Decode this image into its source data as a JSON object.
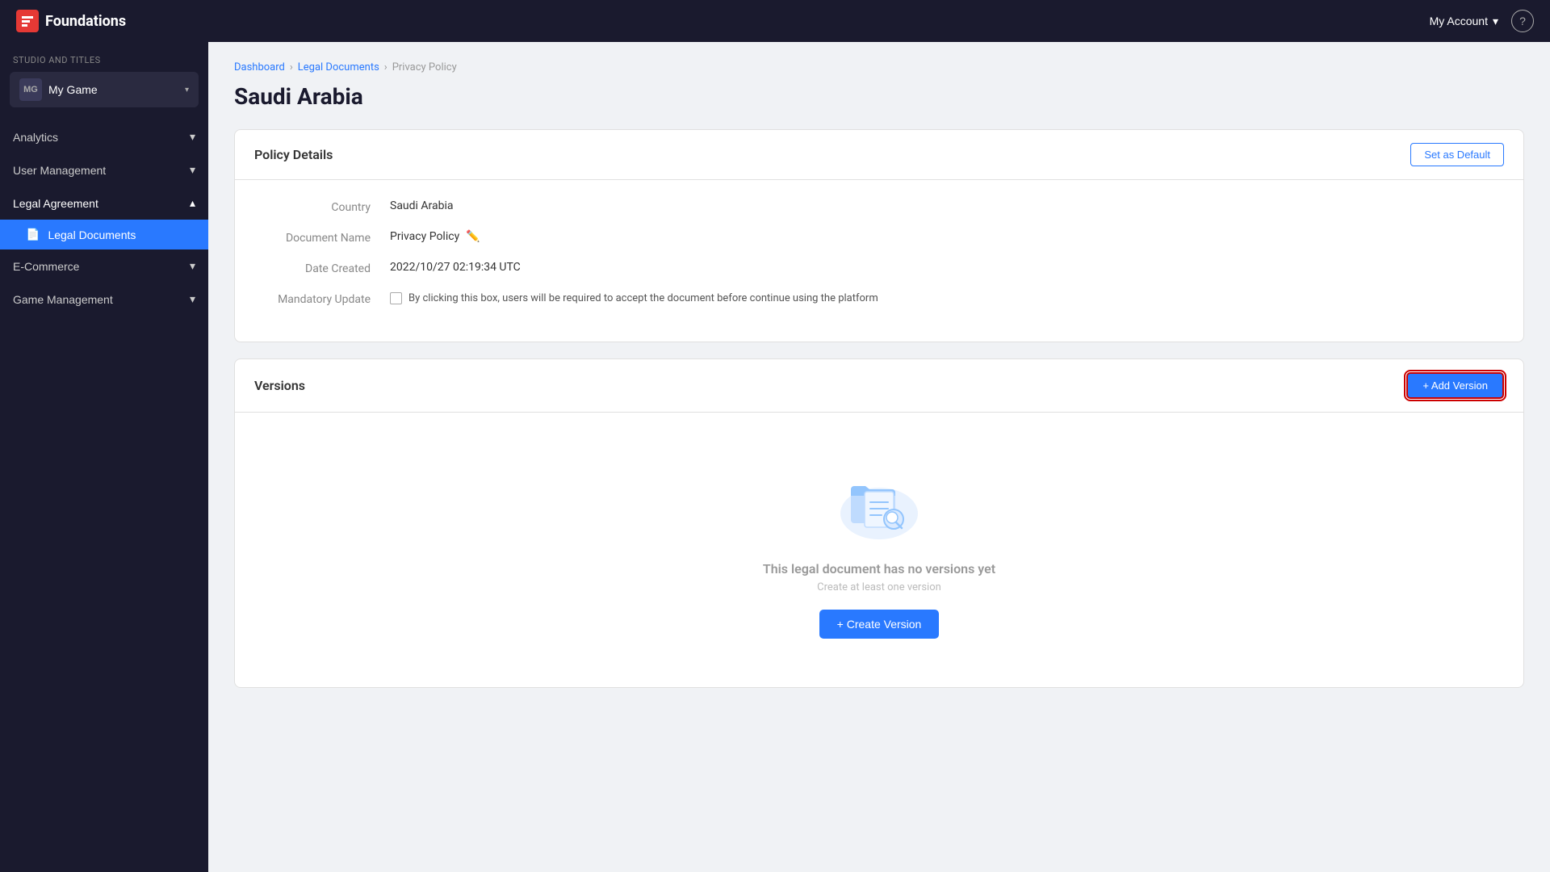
{
  "topnav": {
    "brand_label": "Foundations",
    "my_account_label": "My Account",
    "help_label": "?"
  },
  "sidebar": {
    "studio_label": "STUDIO AND TITLES",
    "studio_avatar": "MG",
    "studio_name": "My Game",
    "nav_items": [
      {
        "id": "analytics",
        "label": "Analytics",
        "has_children": true,
        "expanded": false
      },
      {
        "id": "user-management",
        "label": "User Management",
        "has_children": true,
        "expanded": false
      },
      {
        "id": "legal-agreement",
        "label": "Legal Agreement",
        "has_children": true,
        "expanded": true
      },
      {
        "id": "legal-documents",
        "label": "Legal Documents",
        "active": true,
        "sub": true
      },
      {
        "id": "e-commerce",
        "label": "E-Commerce",
        "has_children": true,
        "expanded": false
      },
      {
        "id": "game-management",
        "label": "Game Management",
        "has_children": true,
        "expanded": false
      }
    ]
  },
  "breadcrumb": {
    "items": [
      "Dashboard",
      "Legal Documents",
      "Privacy Policy"
    ]
  },
  "page": {
    "title": "Saudi Arabia"
  },
  "policy_details": {
    "card_title": "Policy Details",
    "set_default_label": "Set as Default",
    "country_label": "Country",
    "country_value": "Saudi Arabia",
    "document_name_label": "Document Name",
    "document_name_value": "Privacy Policy",
    "date_created_label": "Date Created",
    "date_created_value": "2022/10/27 02:19:34 UTC",
    "mandatory_update_label": "Mandatory Update",
    "mandatory_update_text": "By clicking this box, users will be required to accept the document before continue using the platform"
  },
  "versions": {
    "section_title": "Versions",
    "add_version_label": "+ Add Version",
    "empty_title": "This legal document has no versions yet",
    "empty_sub": "Create at least one version",
    "create_version_label": "+ Create Version"
  }
}
